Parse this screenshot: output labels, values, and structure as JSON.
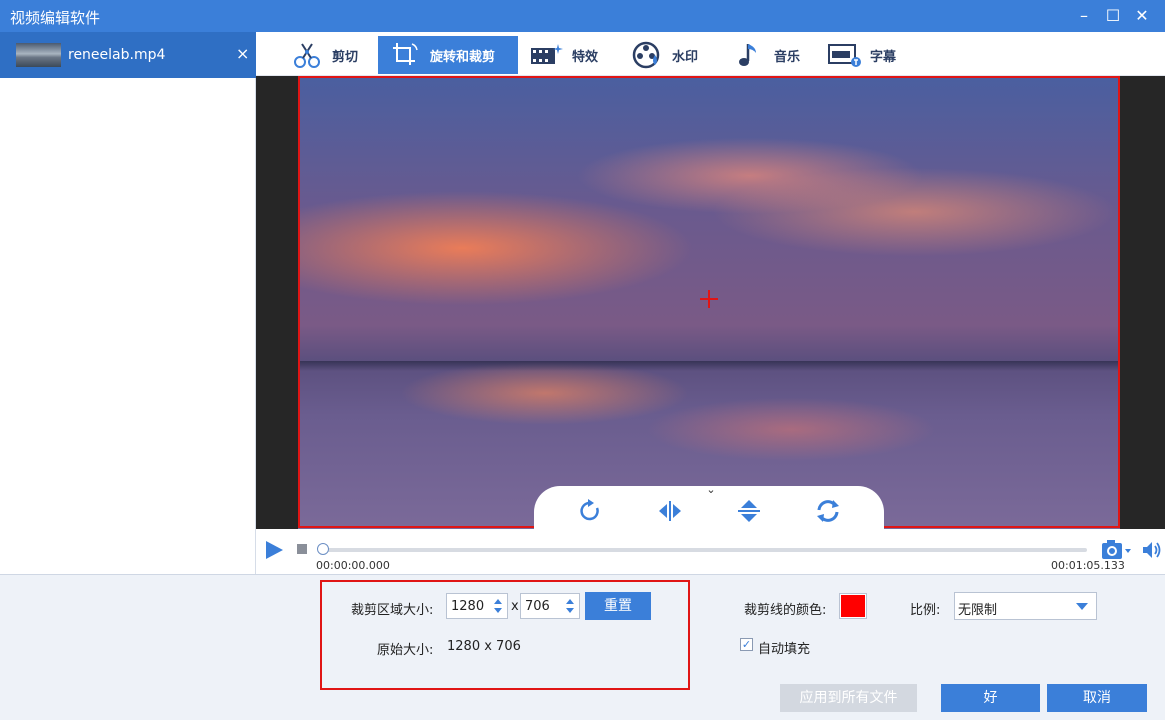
{
  "window": {
    "title": "视频编辑软件",
    "minimize": "–",
    "maximize": "☐",
    "close": "✕"
  },
  "file_list": {
    "items": [
      {
        "name": "reneelab.mp4",
        "close": "×"
      }
    ]
  },
  "toolbar": {
    "tabs": [
      {
        "label": "剪切",
        "icon": "scissors-icon"
      },
      {
        "label": "旋转和裁剪",
        "icon": "crop-rotate-icon"
      },
      {
        "label": "特效",
        "icon": "effects-icon"
      },
      {
        "label": "水印",
        "icon": "watermark-icon"
      },
      {
        "label": "音乐",
        "icon": "music-icon"
      },
      {
        "label": "字幕",
        "icon": "subtitle-icon"
      }
    ],
    "active_index": 1
  },
  "player": {
    "current_time": "00:00:00.000",
    "total_time": "00:01:05.133"
  },
  "crop": {
    "area_label": "裁剪区域大小:",
    "width": "1280",
    "times": "x",
    "height": "706",
    "reset_label": "重置",
    "original_label": "原始大小:",
    "original_value": "1280 x 706",
    "line_color_label": "裁剪线的颜色:",
    "line_color": "#ff0000",
    "ratio_label": "比例:",
    "ratio_value": "无限制",
    "autofill_label": "自动填充",
    "autofill_checked": true
  },
  "actions": {
    "apply_all": "应用到所有文件",
    "ok": "好",
    "cancel": "取消"
  },
  "colors": {
    "accent": "#3b7fd9",
    "crop_frame": "#e01515"
  }
}
